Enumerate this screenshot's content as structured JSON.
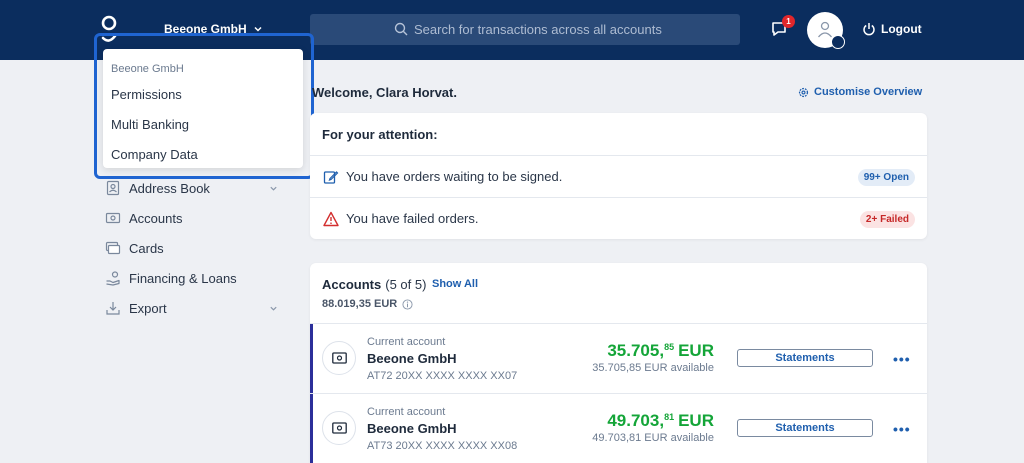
{
  "header": {
    "company_name": "Beeone GmbH",
    "search_placeholder": "Search for transactions across all accounts",
    "notifications_count": "1",
    "logout_label": "Logout"
  },
  "company_dropdown": {
    "header": "Beeone GmbH",
    "items": [
      {
        "label": "Permissions"
      },
      {
        "label": "Multi Banking"
      },
      {
        "label": "Company Data"
      }
    ]
  },
  "sidebar": {
    "items": [
      {
        "label": "Address Book",
        "icon": "address-book-icon",
        "expandable": true
      },
      {
        "label": "Accounts",
        "icon": "accounts-icon"
      },
      {
        "label": "Cards",
        "icon": "cards-icon"
      },
      {
        "label": "Financing & Loans",
        "icon": "financing-icon"
      },
      {
        "label": "Export",
        "icon": "export-icon",
        "expandable": true
      }
    ]
  },
  "main": {
    "welcome": "Welcome, Clara Horvat.",
    "customise_label": "Customise Overview",
    "attention": {
      "title": "For your attention:",
      "rows": [
        {
          "text": "You have orders waiting to be signed.",
          "badge": "99+ Open",
          "icon": "edit-icon"
        },
        {
          "text": "You have failed orders.",
          "badge": "2+ Failed",
          "icon": "warning-icon"
        }
      ]
    },
    "accounts": {
      "title": "Accounts",
      "count": "(5 of 5)",
      "show_all": "Show All",
      "total": "88.019,35 EUR",
      "statements_label": "Statements",
      "items": [
        {
          "type": "Current account",
          "name": "Beeone GmbH",
          "iban": "AT72 20XX XXXX XXXX XX07",
          "amount_main": "35.705,",
          "amount_cents": "85",
          "currency": "EUR",
          "available": "35.705,85 EUR available"
        },
        {
          "type": "Current account",
          "name": "Beeone GmbH",
          "iban": "AT73 20XX XXXX XXXX XX08",
          "amount_main": "49.703,",
          "amount_cents": "81",
          "currency": "EUR",
          "available": "49.703,81 EUR available"
        }
      ]
    }
  },
  "colors": {
    "topbar": "#0b2d5e",
    "accent": "#1f5fae",
    "positive": "#14a538",
    "highlight": "#1f64d1"
  }
}
